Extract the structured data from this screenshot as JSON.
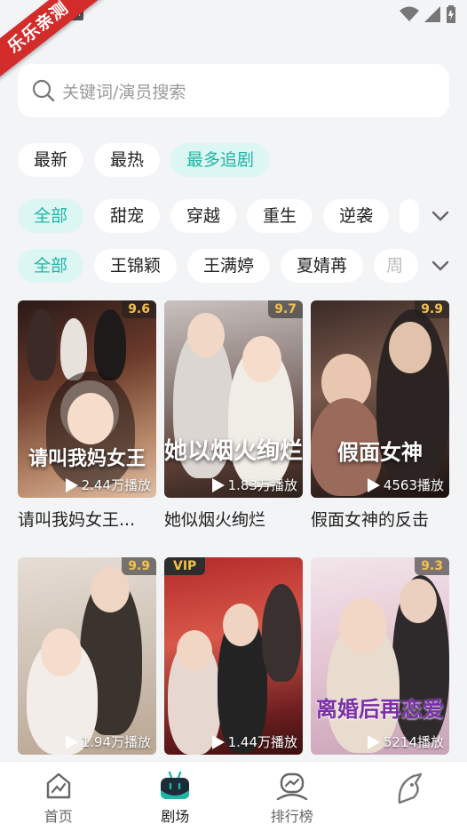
{
  "watermark": "乐乐亲测",
  "search": {
    "placeholder": "关键词/演员搜索"
  },
  "sort_tabs": [
    {
      "label": "最新",
      "active": false
    },
    {
      "label": "最热",
      "active": false
    },
    {
      "label": "最多追剧",
      "active": true
    }
  ],
  "genre_filters": [
    "全部",
    "甜宠",
    "穿越",
    "重生",
    "逆袭"
  ],
  "actor_filters": [
    "全部",
    "王锦颖",
    "王满婷",
    "夏婧苒",
    "周"
  ],
  "dramas": [
    {
      "title": "请叫我妈女王...",
      "rating": "9.6",
      "plays": "2.44万播放",
      "poster_text": "请叫我妈女王"
    },
    {
      "title": "她似烟火绚烂",
      "rating": "9.7",
      "plays": "1.83万播放",
      "poster_text": "她以烟火绚烂"
    },
    {
      "title": "假面女神的反击",
      "rating": "9.9",
      "plays": "4563播放",
      "poster_text": "假面女神"
    },
    {
      "title": "",
      "rating": "9.9",
      "plays": "1.94万播放",
      "poster_text": ""
    },
    {
      "title": "",
      "badge": "VIP",
      "plays": "1.44万播放",
      "poster_text": ""
    },
    {
      "title": "",
      "rating": "9.3",
      "plays": "5214播放",
      "poster_text": "离婚后再恋爱"
    }
  ],
  "bottom_nav": [
    {
      "label": "首页",
      "icon": "home-chart-icon"
    },
    {
      "label": "剧场",
      "icon": "theater-tv-icon",
      "active": true
    },
    {
      "label": "排行榜",
      "icon": "ranking-icon"
    },
    {
      "label": "",
      "icon": "profile-icon"
    }
  ],
  "colors": {
    "accent": "#1fb6a6",
    "accent_bg": "#dcf6f3",
    "watermark_red": "#d42b2b",
    "rating_gold": "#f3c14b"
  }
}
